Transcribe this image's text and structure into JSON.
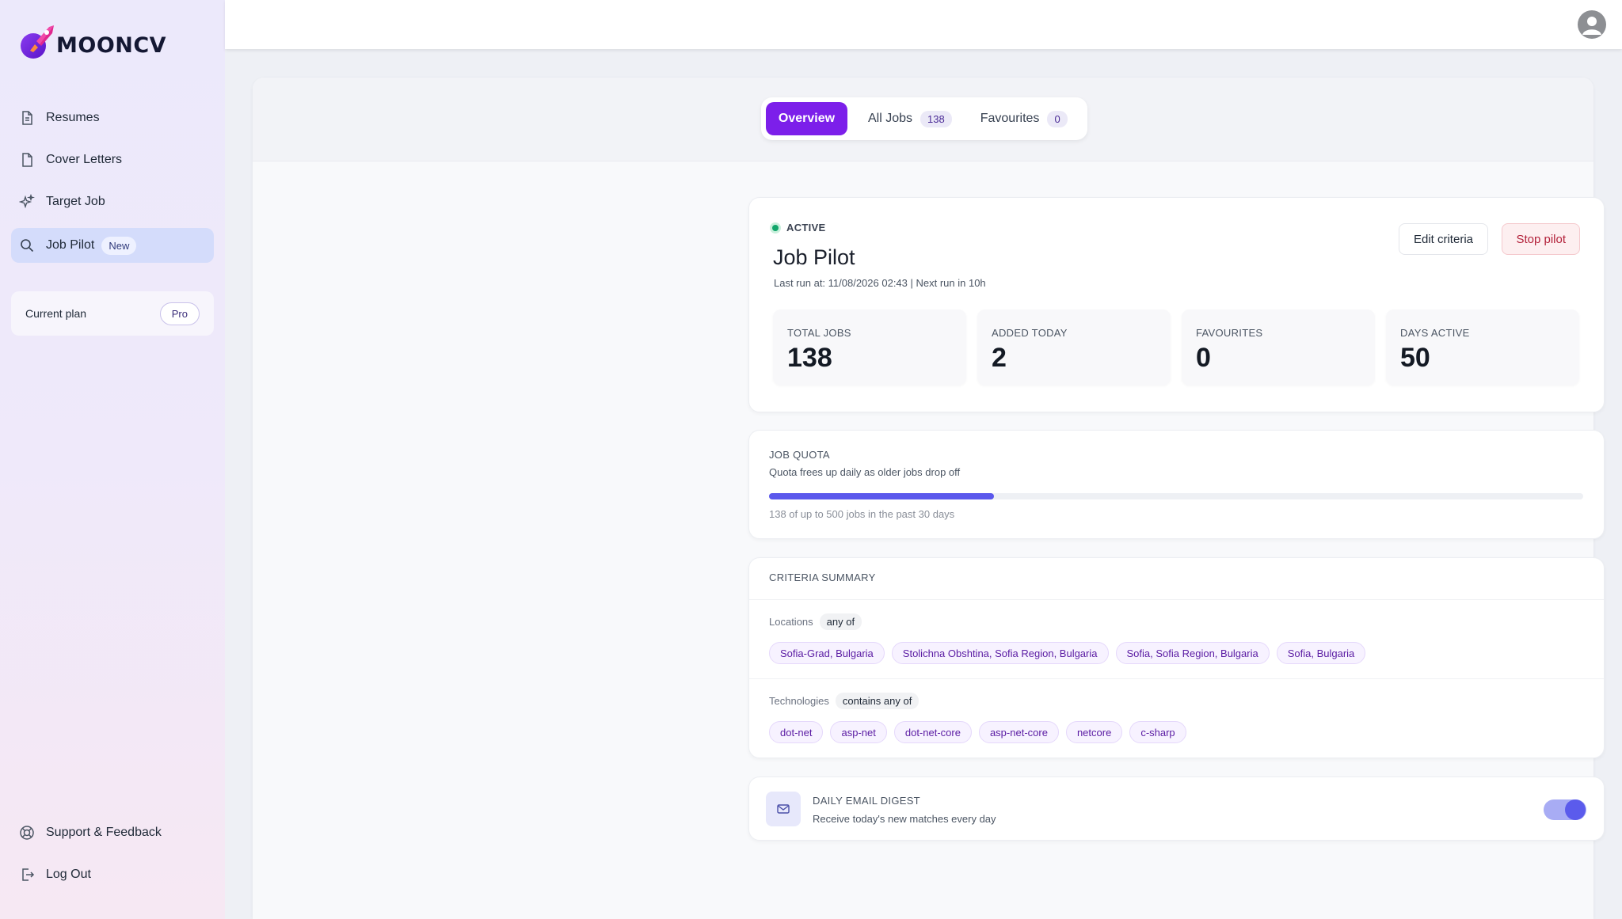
{
  "app": {
    "name": "MOONCV"
  },
  "sidebar": {
    "items": [
      {
        "label": "Resumes",
        "icon": "document-icon"
      },
      {
        "label": "Cover Letters",
        "icon": "file-icon"
      },
      {
        "label": "Target Job",
        "icon": "sparkles-icon"
      },
      {
        "label": "Job Pilot",
        "icon": "search-icon",
        "badge": "New",
        "active": true
      }
    ],
    "plan": {
      "label": "Current plan",
      "value": "Pro"
    },
    "footer": [
      {
        "label": "Support & Feedback",
        "icon": "lifebuoy-icon"
      },
      {
        "label": "Log Out",
        "icon": "logout-icon"
      }
    ]
  },
  "tabs": [
    {
      "label": "Overview",
      "active": true
    },
    {
      "label": "All Jobs",
      "count": "138"
    },
    {
      "label": "Favourites",
      "count": "0"
    }
  ],
  "pilot": {
    "status": "ACTIVE",
    "title": "Job Pilot",
    "meta": "Last run at: 11/08/2026 02:43 | Next run in 10h",
    "edit_label": "Edit criteria",
    "stop_label": "Stop pilot",
    "stats": [
      {
        "label": "TOTAL JOBS",
        "value": "138"
      },
      {
        "label": "ADDED TODAY",
        "value": "2"
      },
      {
        "label": "FAVOURITES",
        "value": "0"
      },
      {
        "label": "DAYS ACTIVE",
        "value": "50"
      }
    ]
  },
  "quota": {
    "title": "JOB QUOTA",
    "subtitle": "Quota frees up daily as older jobs drop off",
    "used": 138,
    "max": 500,
    "caption": "138 of up to 500 jobs in the past 30 days"
  },
  "criteria": {
    "title": "CRITERIA SUMMARY",
    "locations": {
      "label": "Locations",
      "op": "any of",
      "items": [
        "Sofia-Grad, Bulgaria",
        "Stolichna Obshtina, Sofia Region, Bulgaria",
        "Sofia, Sofia Region, Bulgaria",
        "Sofia, Bulgaria"
      ]
    },
    "technologies": {
      "label": "Technologies",
      "op": "contains any of",
      "items": [
        "dot-net",
        "asp-net",
        "dot-net-core",
        "asp-net-core",
        "netcore",
        "c-sharp"
      ]
    }
  },
  "digest": {
    "title": "DAILY EMAIL DIGEST",
    "subtitle": "Receive today's new matches every day",
    "enabled": true
  },
  "colors": {
    "accent": "#7c1fea",
    "progress": "#5b58ec",
    "active_dot": "#11a66b"
  }
}
